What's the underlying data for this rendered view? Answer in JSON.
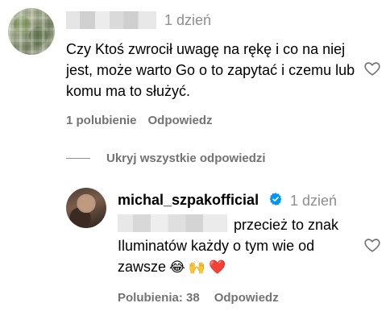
{
  "comment": {
    "time": "1 dzień",
    "text": "Czy Ktoś zwrocił uwagę na rękę i co na niej jest, może warto Go o to zapytać i czemu lub komu ma to służyć.",
    "likes_label": "1 polubienie",
    "reply_label": "Odpowiedz",
    "like_icon": "heart-outline-icon"
  },
  "thread": {
    "hide_replies_label": "Ukryj wszystkie odpowiedzi"
  },
  "reply": {
    "username": "michal_szpakofficial",
    "verified_icon": "verified-badge-icon",
    "time": "1 dzień",
    "text_line1": "przecież to znak",
    "text_line2": "Iluminatów każdy o tym wie od",
    "text_line3": "zawsze",
    "emojis": [
      "😂",
      "🙌",
      "❤️"
    ],
    "likes_label": "Polubienia: 38",
    "reply_label": "Odpowiedz",
    "like_icon": "heart-outline-icon",
    "colors": {
      "verified": "#0095f6"
    }
  }
}
